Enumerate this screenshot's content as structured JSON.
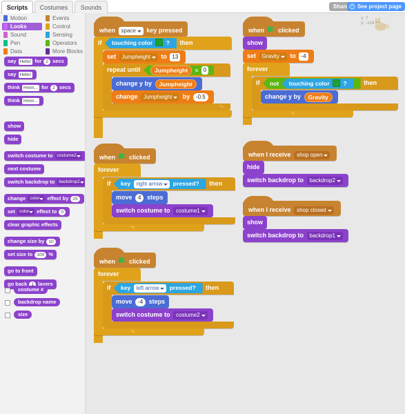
{
  "app": {
    "tabs": [
      {
        "label": "Scripts",
        "active": true
      },
      {
        "label": "Costumes",
        "active": false
      },
      {
        "label": "Sounds",
        "active": false
      }
    ],
    "share_label": "Share",
    "see_project_label": "See project page",
    "globe_icon": "globe-icon"
  },
  "palette": {
    "categories": [
      {
        "label": "Motion",
        "color": "#4a6cd4",
        "selected": false
      },
      {
        "label": "Looks",
        "color": "#9966ff",
        "selected": true
      },
      {
        "label": "Sound",
        "color": "#cf63cf",
        "selected": false
      },
      {
        "label": "Pen",
        "color": "#0fbd8c",
        "selected": false
      },
      {
        "label": "Data",
        "color": "#ee7d16",
        "selected": false
      },
      {
        "label": "Events",
        "color": "#c88330",
        "selected": false
      },
      {
        "label": "Control",
        "color": "#e0a21a",
        "selected": false
      },
      {
        "label": "Sensing",
        "color": "#2ca5e2",
        "selected": false
      },
      {
        "label": "Operators",
        "color": "#5cb712",
        "selected": false
      },
      {
        "label": "More Blocks",
        "color": "#632d99",
        "selected": false
      }
    ],
    "blocks": {
      "say_for": {
        "pre": "say",
        "field": "Hello!",
        "mid": "for",
        "num": "2",
        "post": "secs"
      },
      "say": {
        "pre": "say",
        "field": "Hello!"
      },
      "think_for": {
        "pre": "think",
        "field": "Hmm...",
        "mid": "for",
        "num": "2",
        "post": "secs"
      },
      "think": {
        "pre": "think",
        "field": "Hmm..."
      },
      "show": "show",
      "hide": "hide",
      "switch_costume": {
        "pre": "switch costume to",
        "value": "costume2"
      },
      "next_costume": "next costume",
      "switch_backdrop": {
        "pre": "switch backdrop to",
        "value": "backdrop2"
      },
      "change_effect": {
        "pre": "change",
        "value": "color",
        "mid": "effect by",
        "num": "25"
      },
      "set_effect": {
        "pre": "set",
        "value": "color",
        "mid": "effect to",
        "num": "0"
      },
      "clear_effects": "clear graphic effects",
      "change_size": {
        "pre": "change size by",
        "num": "10"
      },
      "set_size": {
        "pre": "set size to",
        "num": "100",
        "post": "%"
      },
      "go_to_front": "go to front",
      "go_back": {
        "pre": "go back",
        "num": "1",
        "post": "layers"
      },
      "reporters": [
        {
          "label": "costume #",
          "checked": false
        },
        {
          "label": "backdrop name",
          "checked": false
        },
        {
          "label": "size",
          "checked": false
        }
      ]
    }
  },
  "stage_info": {
    "sprite_icon": "sprite-cat-icon",
    "x_label": "x: 7",
    "y_label": "y: -118"
  },
  "scripts": {
    "jump": {
      "hat": {
        "pre": "when",
        "key": "space",
        "post": "key pressed"
      },
      "if_label": "if",
      "then_label": "then",
      "condition": {
        "label": "touching color",
        "color": "#1fa02f",
        "q": "?"
      },
      "set": {
        "pre": "set",
        "var": "Jumpheight",
        "mid": "to",
        "value": "13"
      },
      "repeat_until": {
        "pre": "repeat until",
        "var": "Jumpheight",
        "op": "=",
        "value": "0"
      },
      "change_y": {
        "pre": "change y by",
        "var": "Jumpheight"
      },
      "change_var": {
        "pre": "change",
        "var": "Jumpheight",
        "mid": "by",
        "value": "-0.5"
      }
    },
    "gravity": {
      "hat": {
        "pre": "when",
        "flag": "green-flag-icon",
        "post": "clicked"
      },
      "show": "show",
      "set": {
        "pre": "set",
        "var": "Gravity",
        "mid": "to",
        "value": "-4"
      },
      "forever": "forever",
      "if_label": "if",
      "then_label": "then",
      "not_label": "not",
      "condition": {
        "label": "touching color",
        "color": "#1fa02f",
        "q": "?"
      },
      "change_y": {
        "pre": "change y by",
        "var": "Gravity"
      }
    },
    "move_right": {
      "hat": {
        "pre": "when",
        "flag": "green-flag-icon",
        "post": "clicked"
      },
      "forever": "forever",
      "if_label": "if",
      "then_label": "then",
      "condition": {
        "pre": "key",
        "key": "right arrow",
        "post": "pressed?"
      },
      "move": {
        "pre": "move",
        "value": "4",
        "post": "steps"
      },
      "switch_costume": {
        "pre": "switch costume to",
        "value": "costume1"
      }
    },
    "move_left": {
      "hat": {
        "pre": "when",
        "flag": "green-flag-icon",
        "post": "clicked"
      },
      "forever": "forever",
      "if_label": "if",
      "then_label": "then",
      "condition": {
        "pre": "key",
        "key": "left arrow",
        "post": "pressed?"
      },
      "move": {
        "pre": "move",
        "value": "-4",
        "post": "steps"
      },
      "switch_costume": {
        "pre": "switch costume to",
        "value": "costume2"
      }
    },
    "shop_open": {
      "hat": {
        "pre": "when I receive",
        "msg": "shop open"
      },
      "hide": "hide",
      "switch_backdrop": {
        "pre": "switch backdrop to",
        "value": "backdrop2"
      }
    },
    "shop_closed": {
      "hat": {
        "pre": "when I receive",
        "msg": "shop closed"
      },
      "show": "show",
      "switch_backdrop": {
        "pre": "switch backdrop to",
        "value": "backdrop1"
      }
    }
  }
}
